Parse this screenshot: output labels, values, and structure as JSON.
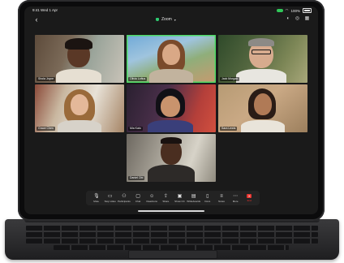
{
  "status_bar": {
    "time": "9:41",
    "date": "Wed 1 Apr",
    "battery": "100%"
  },
  "header": {
    "back_icon": "chevron-left-icon",
    "title": "Zoom",
    "secure_icon": "shield-icon",
    "right_icons": [
      "speaker-icon",
      "camera-switch-icon",
      "grid-icon"
    ]
  },
  "participants": [
    {
      "name": "Shola Joyce",
      "speaking": false
    },
    {
      "name": "Olivia Loftus",
      "speaking": true
    },
    {
      "name": "Jack Morgan",
      "speaking": false
    },
    {
      "name": "Grace Chen",
      "speaking": false
    },
    {
      "name": "Mia Kato",
      "speaking": false
    },
    {
      "name": "Sara Lewis",
      "speaking": false
    },
    {
      "name": "Daniel Obi",
      "speaking": false
    }
  ],
  "controls": [
    {
      "label": "Mute",
      "icon": "microphone-icon"
    },
    {
      "label": "Stop video",
      "icon": "video-camera-icon"
    },
    {
      "label": "Participants",
      "icon": "participants-icon"
    },
    {
      "label": "Chat",
      "icon": "chat-icon"
    },
    {
      "label": "Reactions",
      "icon": "reactions-icon"
    },
    {
      "label": "Share",
      "icon": "share-icon"
    },
    {
      "label": "Show CC",
      "icon": "captions-icon"
    },
    {
      "label": "Whiteboards",
      "icon": "whiteboard-icon"
    },
    {
      "label": "Docs",
      "icon": "docs-icon"
    },
    {
      "label": "Notes",
      "icon": "notes-icon"
    },
    {
      "label": "More",
      "icon": "more-icon"
    },
    {
      "label": "End",
      "icon": "end-call-icon"
    }
  ],
  "colors": {
    "accent_green": "#4cd964",
    "end_red": "#e5322d"
  }
}
